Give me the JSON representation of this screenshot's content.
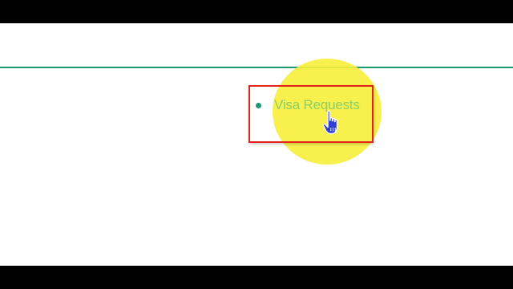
{
  "nav": {
    "items": [
      {
        "label": "Visa Requests",
        "state": "hovered"
      }
    ]
  },
  "theme": {
    "accent_color": "#1e9a70",
    "link_hover_color": "#8dcf64",
    "focus_box_color": "#e2231a",
    "cursor_highlight_color": "#f7ee3a"
  },
  "cursor": {
    "icon": "hand-pointer-icon"
  }
}
